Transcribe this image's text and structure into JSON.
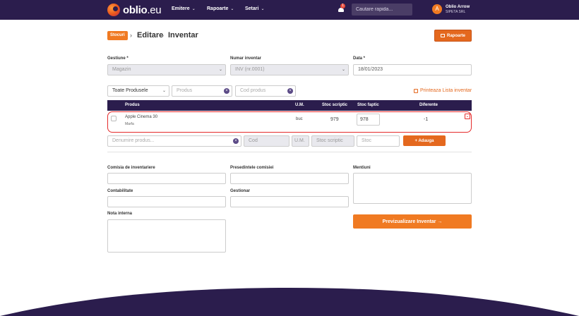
{
  "brand": {
    "name": "oblio",
    "suffix": ".eu"
  },
  "nav": [
    {
      "label": "Emitere"
    },
    {
      "label": "Rapoarte"
    },
    {
      "label": "Setari"
    }
  ],
  "notifications": {
    "count": "1"
  },
  "search": {
    "placeholder": "Cautare rapida..."
  },
  "user": {
    "initial": "A",
    "name": "Oblio Arrow",
    "company": "SIPETA SRL"
  },
  "breadcrumb": {
    "badge": "Stocuri",
    "items": [
      "Editare",
      "Inventar"
    ]
  },
  "rapoarte_button": "Rapoarte",
  "form": {
    "gestiune": {
      "label": "Gestiune *",
      "value": "Magazin"
    },
    "numar": {
      "label": "Numar inventar",
      "value": "INV (nr.0001)"
    },
    "data": {
      "label": "Data *",
      "value": "18/01/2023"
    }
  },
  "filters": {
    "category": "Toate Produsele",
    "produs_placeholder": "Produs",
    "cod_placeholder": "Cod produs"
  },
  "print_link": "Printeaza Lista inventar",
  "table": {
    "headers": {
      "produs": "Produs",
      "um": "U.M.",
      "scriptic": "Stoc scriptic",
      "faptic": "Stoc faptic",
      "diferente": "Diferente"
    },
    "rows": [
      {
        "name": "Apple Cinema 30",
        "type": "Marfa",
        "um": "buc",
        "scriptic": "979",
        "faptic": "978",
        "diff": "-1"
      }
    ]
  },
  "add_row": {
    "name_placeholder": "Denumire produs...",
    "cod_placeholder": "Cod",
    "um_placeholder": "U.M.",
    "scriptic_placeholder": "Stoc scriptic",
    "stoc_placeholder": "Stoc",
    "button": "+ Adauga"
  },
  "bottom": {
    "comisia": "Comisia de inventariere",
    "presedinte": "Presedintele comisiei",
    "mentiuni": "Mentiuni",
    "contabilitate": "Contabilitate",
    "gestionar": "Gestionar",
    "nota": "Nota interna",
    "preview_button": "Previzualizare Inventar →"
  },
  "colors": {
    "accent": "#f07a22",
    "header": "#2b1d4d",
    "highlight": "#e52b2b"
  }
}
